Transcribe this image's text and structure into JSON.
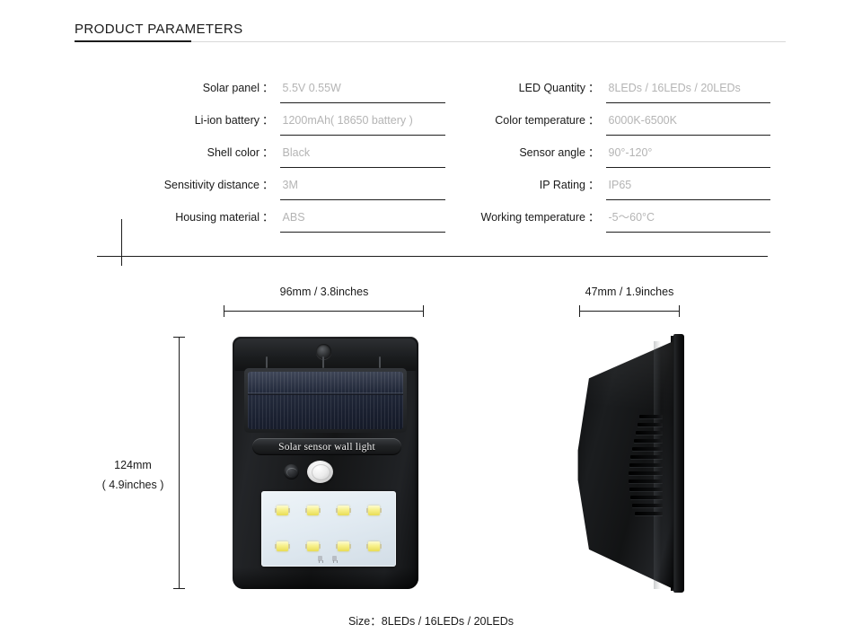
{
  "title": "PRODUCT PARAMETERS",
  "specs": {
    "left": [
      {
        "label": "Solar panel",
        "colon": "：",
        "value": "5.5V 0.55W"
      },
      {
        "label": "Li-ion battery",
        "colon": "：",
        "value": "1200mAh( 18650 battery )"
      },
      {
        "label": "Shell color",
        "colon": "：",
        "value": "Black"
      },
      {
        "label": "Sensitivity distance",
        "colon": "：",
        "value": "3M"
      },
      {
        "label": "Housing material",
        "colon": "：",
        "value": "ABS"
      }
    ],
    "right": [
      {
        "label": "LED Quantity",
        "colon": "：",
        "value": "8LEDs / 16LEDs / 20LEDs"
      },
      {
        "label": "Color temperature",
        "colon": "：",
        "value": "6000K-6500K"
      },
      {
        "label": "Sensor angle",
        "colon": "：",
        "value": "90°-120°"
      },
      {
        "label": "IP Rating",
        "colon": "：",
        "value": "IP65"
      },
      {
        "label": "Working temperature",
        "colon": "：",
        "value": "-5～60°C"
      }
    ]
  },
  "dimensions": {
    "width": "96mm / 3.8inches",
    "depth": "47mm / 1.9inches",
    "height_mm": "124mm",
    "height_in": "( 4.9inches )"
  },
  "product": {
    "banner_text": "Solar sensor wall light",
    "led_count": 8
  },
  "bottom_caption": "Size：8LEDs / 16LEDs / 20LEDs",
  "colors": {
    "text": "#1a1a1a",
    "value_text": "#b4b4b4",
    "rule": "#1d1d1d",
    "rule_light": "#d8d8d8",
    "body": "#17181a",
    "led": "#f7f08a",
    "panel": "#e2ebf2"
  }
}
